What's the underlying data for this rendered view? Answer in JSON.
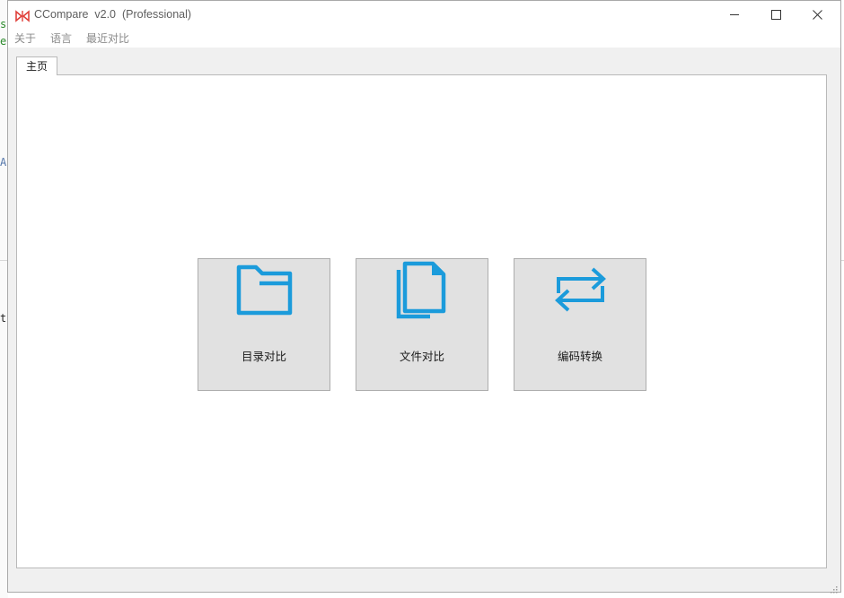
{
  "background_window": {
    "left_chars": [
      "s",
      "e",
      "A",
      "t"
    ]
  },
  "titlebar": {
    "title": "CCompare  v2.0  (Professional)",
    "icon": "ccompare-logo-icon"
  },
  "window_controls": {
    "minimize_icon": "minimize-icon",
    "maximize_icon": "maximize-icon",
    "close_icon": "close-icon"
  },
  "menu": {
    "items": [
      {
        "label": "关于"
      },
      {
        "label": "语言"
      },
      {
        "label": "最近对比"
      }
    ]
  },
  "tabs": [
    {
      "label": "主页",
      "selected": true
    }
  ],
  "tiles": [
    {
      "label": "目录对比",
      "icon": "folder-icon"
    },
    {
      "label": "文件对比",
      "icon": "files-icon"
    },
    {
      "label": "编码转换",
      "icon": "convert-arrows-icon"
    }
  ],
  "colors": {
    "accent": "#1b9bdb",
    "tile_bg": "#e1e1e1",
    "window_bg": "#f0f0f0",
    "logo_red": "#e0403a"
  }
}
